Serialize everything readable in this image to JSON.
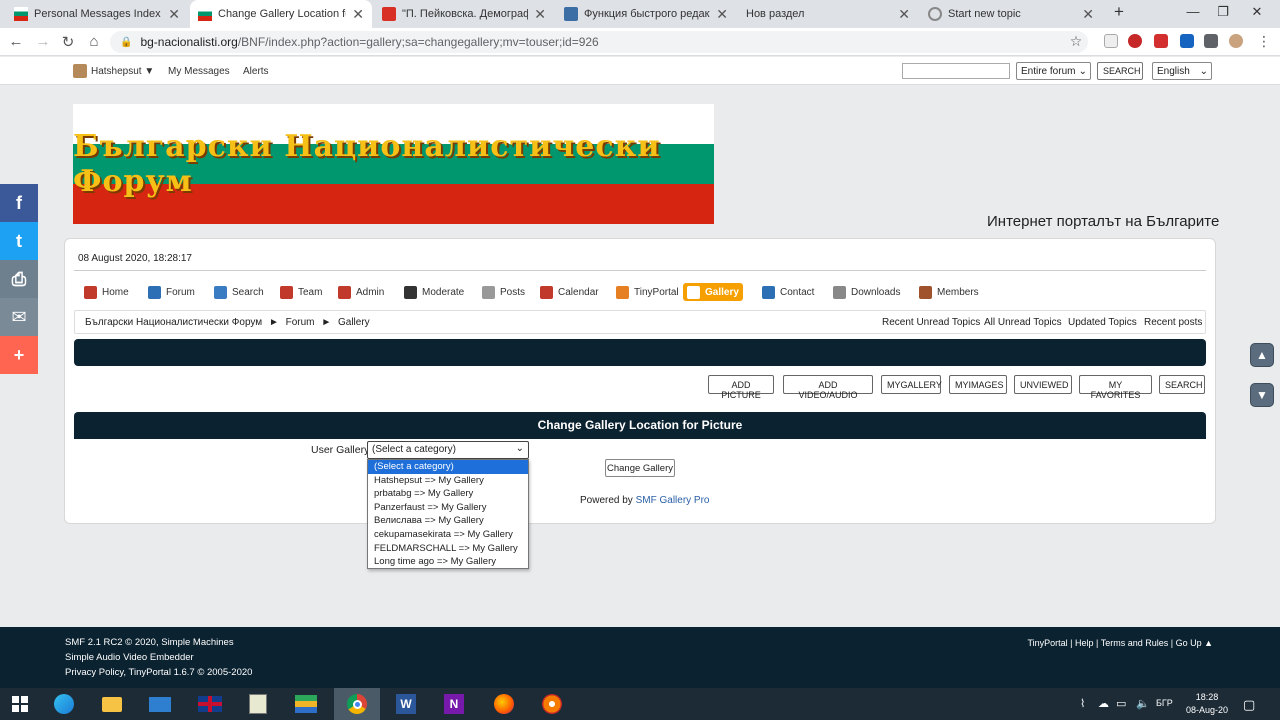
{
  "browser": {
    "tabs": [
      {
        "title": "Personal Messages Index",
        "active": false
      },
      {
        "title": "Change Gallery Location for Pictu",
        "active": true
      },
      {
        "title": "\"П. Пейковска. Демографс",
        "active": false
      },
      {
        "title": "Функция быстрого редактиро",
        "active": false
      },
      {
        "title": "Нов раздел",
        "active": false
      },
      {
        "title": "Start new topic",
        "active": false
      }
    ],
    "new_tab": "+",
    "url_domain": "bg-nacionalisti.org",
    "url_path": "/BNF/index.php?action=gallery;sa=changegallery;mv=touser;id=926"
  },
  "userbar": {
    "username": "Hatshepsut ▼",
    "my_messages": "My Messages",
    "alerts": "Alerts",
    "search_scope": "Entire forum",
    "search_button": "SEARCH",
    "language": "English"
  },
  "banner": {
    "title": "Български Националистически Форум",
    "slogan": "Интернет порталът на Българите"
  },
  "datetime": "08 August 2020, 18:28:17",
  "menu": [
    {
      "label": "Home",
      "color": "#c0392b"
    },
    {
      "label": "Forum",
      "color": "#2c6fb5"
    },
    {
      "label": "Search",
      "color": "#3a7cc2"
    },
    {
      "label": "Team",
      "color": "#c0392b"
    },
    {
      "label": "Admin",
      "color": "#c0392b"
    },
    {
      "label": "Moderate",
      "color": "#333333"
    },
    {
      "label": "Posts",
      "color": "#999999"
    },
    {
      "label": "Calendar",
      "color": "#c0392b"
    },
    {
      "label": "TinyPortal",
      "color": "#e67e22"
    },
    {
      "label": "Gallery",
      "color": "#ffffff"
    },
    {
      "label": "Contact",
      "color": "#2c6fb5"
    },
    {
      "label": "Downloads",
      "color": "#888888"
    },
    {
      "label": "Members",
      "color": "#a0522d"
    }
  ],
  "breadcrumb": {
    "items": [
      "Български Националистически Форум",
      "Forum",
      "Gallery"
    ],
    "separator": "►",
    "links": [
      "Recent Unread Topics",
      "All Unread Topics",
      "Updated Topics",
      "Recent posts"
    ]
  },
  "gallery_buttons": [
    "ADD PICTURE",
    "ADD VIDEO/AUDIO",
    "MYGALLERY",
    "MYIMAGES",
    "UNVIEWED",
    "MY FAVORITES",
    "SEARCH"
  ],
  "form": {
    "header": "Change Gallery Location for Picture",
    "label": "User Gallery",
    "selected": "(Select a category)",
    "options": [
      "(Select a category)",
      "Hatshepsut => My Gallery",
      "prbatabg => My Gallery",
      "Panzerfaust => My Gallery",
      "Велислава => My Gallery",
      "cekupamasekirata => My Gallery",
      "FELDMARSCHALL => My Gallery",
      "Long time ago => My Gallery"
    ],
    "submit": "Change Gallery",
    "powered_prefix": "Powered by ",
    "powered_link": "SMF Gallery Pro"
  },
  "footer": {
    "line1": "SMF 2.1 RC2 © 2020, Simple Machines",
    "line2": "Simple Audio Video Embedder",
    "line3": "Privacy Policy, TinyPortal 1.6.7 © 2005-2020",
    "right": "TinyPortal | Help | Terms and Rules | Go Up ▲"
  },
  "social": [
    {
      "icon": "f",
      "color": "#3b5998"
    },
    {
      "icon": "t",
      "color": "#1da1f2"
    },
    {
      "icon": "⎙",
      "color": "#6e7f8d"
    },
    {
      "icon": "✉",
      "color": "#7a8a97"
    },
    {
      "icon": "+",
      "color": "#ff6550"
    }
  ],
  "taskbar": {
    "language": "БГР",
    "time": "18:28",
    "date": "08-Aug-20"
  }
}
